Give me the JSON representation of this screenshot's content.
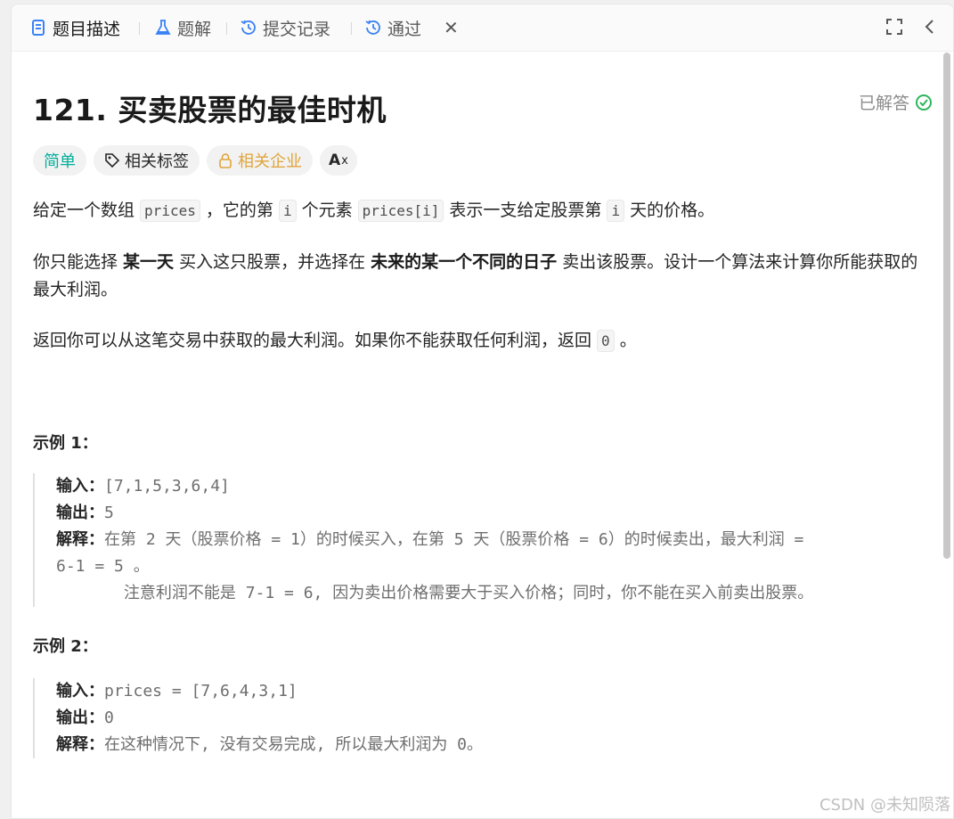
{
  "tabs": [
    {
      "label": "题目描述",
      "icon": "document-icon",
      "active": true
    },
    {
      "label": "题解",
      "icon": "flask-icon"
    },
    {
      "label": "提交记录",
      "icon": "history-icon"
    },
    {
      "label": "通过",
      "icon": "history-icon"
    }
  ],
  "problem": {
    "title": "121. 买卖股票的最佳时机",
    "status": "已解答",
    "tags": {
      "difficulty": "简单",
      "related_tags": "相关标签",
      "related_companies": "相关企业",
      "translate": "A"
    }
  },
  "description": {
    "p1_a": "给定一个数组 ",
    "p1_code1": "prices",
    "p1_b": " ，它的第 ",
    "p1_code2": "i",
    "p1_c": " 个元素 ",
    "p1_code3": "prices[i]",
    "p1_d": " 表示一支给定股票第 ",
    "p1_code4": "i",
    "p1_e": " 天的价格。",
    "p2_a": "你只能选择 ",
    "p2_b1": "某一天",
    "p2_b": " 买入这只股票，并选择在 ",
    "p2_b2": "未来的某一个不同的日子",
    "p2_c": " 卖出该股票。设计一个算法来计算你所能获取的最大利润。",
    "p3_a": "返回你可以从这笔交易中获取的最大利润。如果你不能获取任何利润，返回 ",
    "p3_code": "0",
    "p3_b": " 。"
  },
  "examples": [
    {
      "title": "示例 1：",
      "input_label": "输入：",
      "input": "[7,1,5,3,6,4]",
      "output_label": "输出：",
      "output": "5",
      "explain_label": "解释：",
      "explain_line1": "在第 2 天（股票价格 = 1）的时候买入，在第 5 天（股票价格 = 6）的时候卖出，最大利润 =",
      "explain_line2": "6-1 = 5 。",
      "explain_line3": "       注意利润不能是 7-1 = 6, 因为卖出价格需要大于买入价格；同时，你不能在买入前卖出股票。"
    },
    {
      "title": "示例 2：",
      "input_label": "输入：",
      "input": "prices = [7,6,4,3,1]",
      "output_label": "输出：",
      "output": "0",
      "explain_label": "解释：",
      "explain_line1": "在这种情况下, 没有交易完成, 所以最大利润为 0。"
    }
  ],
  "watermark": "CSDN @未知陨落",
  "colors": {
    "easy": "#00af9b",
    "company": "#e0a43a",
    "solved_check": "#2db55d",
    "tab_icon_blue": "#3b82f6"
  }
}
